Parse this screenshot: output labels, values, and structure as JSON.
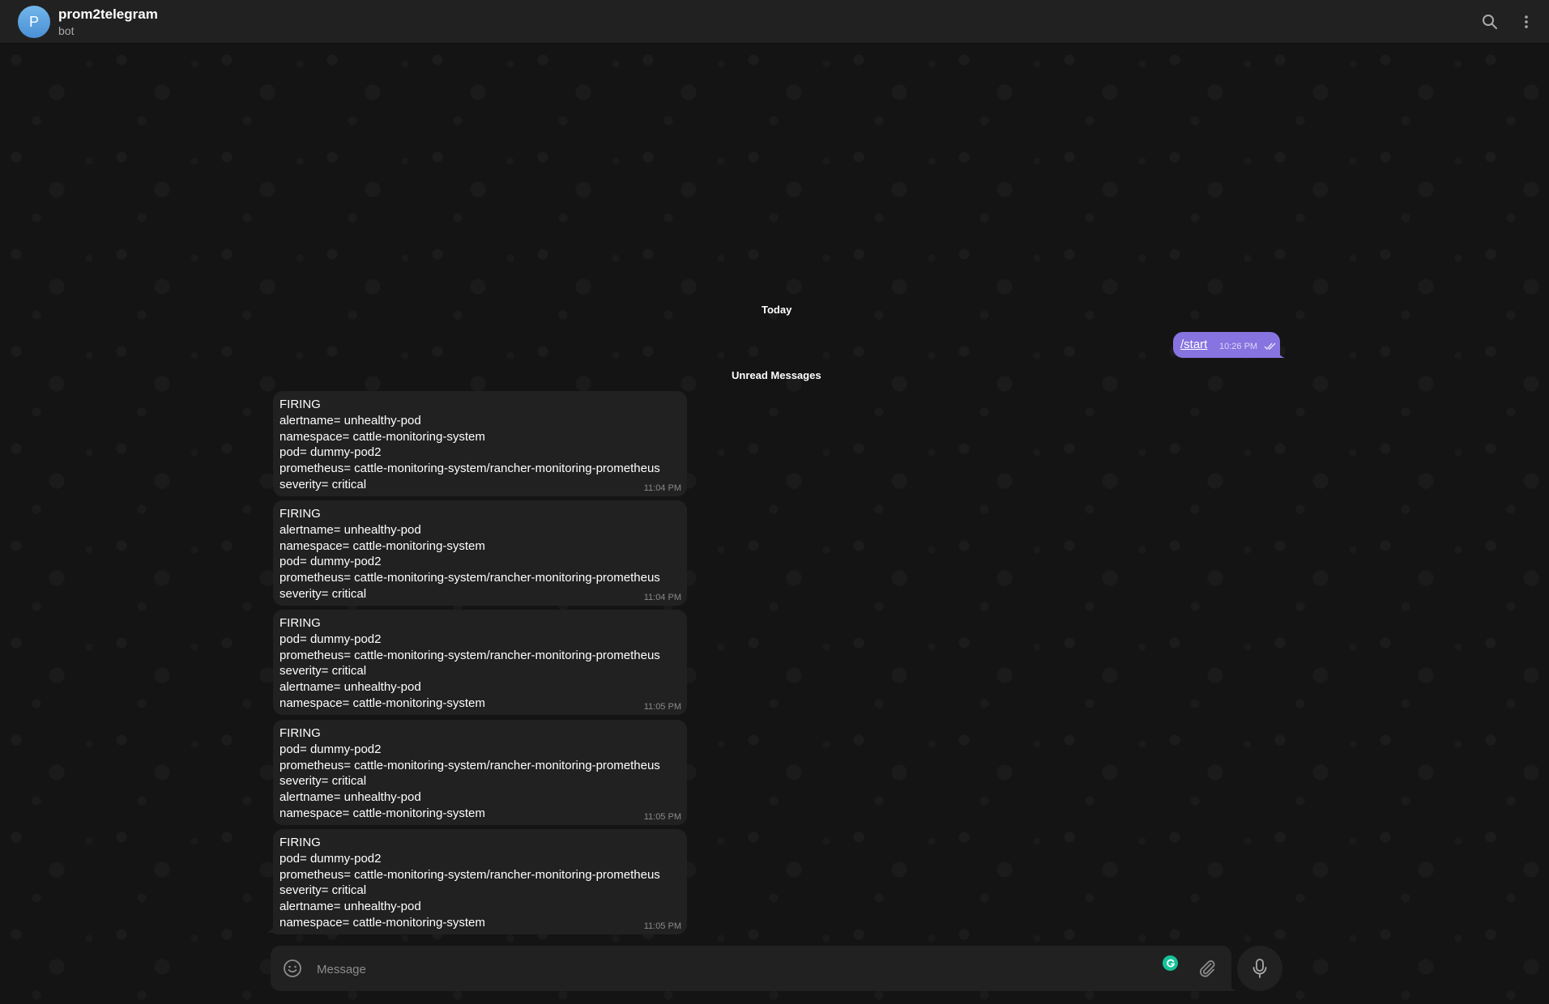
{
  "header": {
    "avatar_letter": "P",
    "title": "prom2telegram",
    "subtitle": "bot"
  },
  "separators": {
    "today": "Today",
    "unread": "Unread Messages"
  },
  "outgoing": {
    "text": "/start",
    "time": "10:26 PM",
    "status": "read"
  },
  "messages": [
    {
      "lines": [
        "FIRING",
        "alertname= unhealthy-pod",
        "namespace= cattle-monitoring-system",
        "pod= dummy-pod2",
        "prometheus= cattle-monitoring-system/rancher-monitoring-prometheus",
        "severity= critical"
      ],
      "time": "11:04 PM"
    },
    {
      "lines": [
        "FIRING",
        "alertname= unhealthy-pod",
        "namespace= cattle-monitoring-system",
        "pod= dummy-pod2",
        "prometheus= cattle-monitoring-system/rancher-monitoring-prometheus",
        "severity= critical"
      ],
      "time": "11:04 PM"
    },
    {
      "lines": [
        "FIRING",
        "pod= dummy-pod2",
        "prometheus= cattle-monitoring-system/rancher-monitoring-prometheus",
        "severity= critical",
        "alertname= unhealthy-pod",
        "namespace= cattle-monitoring-system"
      ],
      "time": "11:05 PM"
    },
    {
      "lines": [
        "FIRING",
        "pod= dummy-pod2",
        "prometheus= cattle-monitoring-system/rancher-monitoring-prometheus",
        "severity= critical",
        "alertname= unhealthy-pod",
        "namespace= cattle-monitoring-system"
      ],
      "time": "11:05 PM"
    },
    {
      "lines": [
        "FIRING",
        "pod= dummy-pod2",
        "prometheus= cattle-monitoring-system/rancher-monitoring-prometheus",
        "severity= critical",
        "alertname= unhealthy-pod",
        "namespace= cattle-monitoring-system"
      ],
      "time": "11:05 PM"
    }
  ],
  "composer": {
    "placeholder": "Message",
    "value": ""
  },
  "colors": {
    "accent": "#8774e1",
    "header_bg": "#212121",
    "bubble_in": "#212121",
    "avatar": "#5aa2e0",
    "grammarly": "#15c39a"
  }
}
